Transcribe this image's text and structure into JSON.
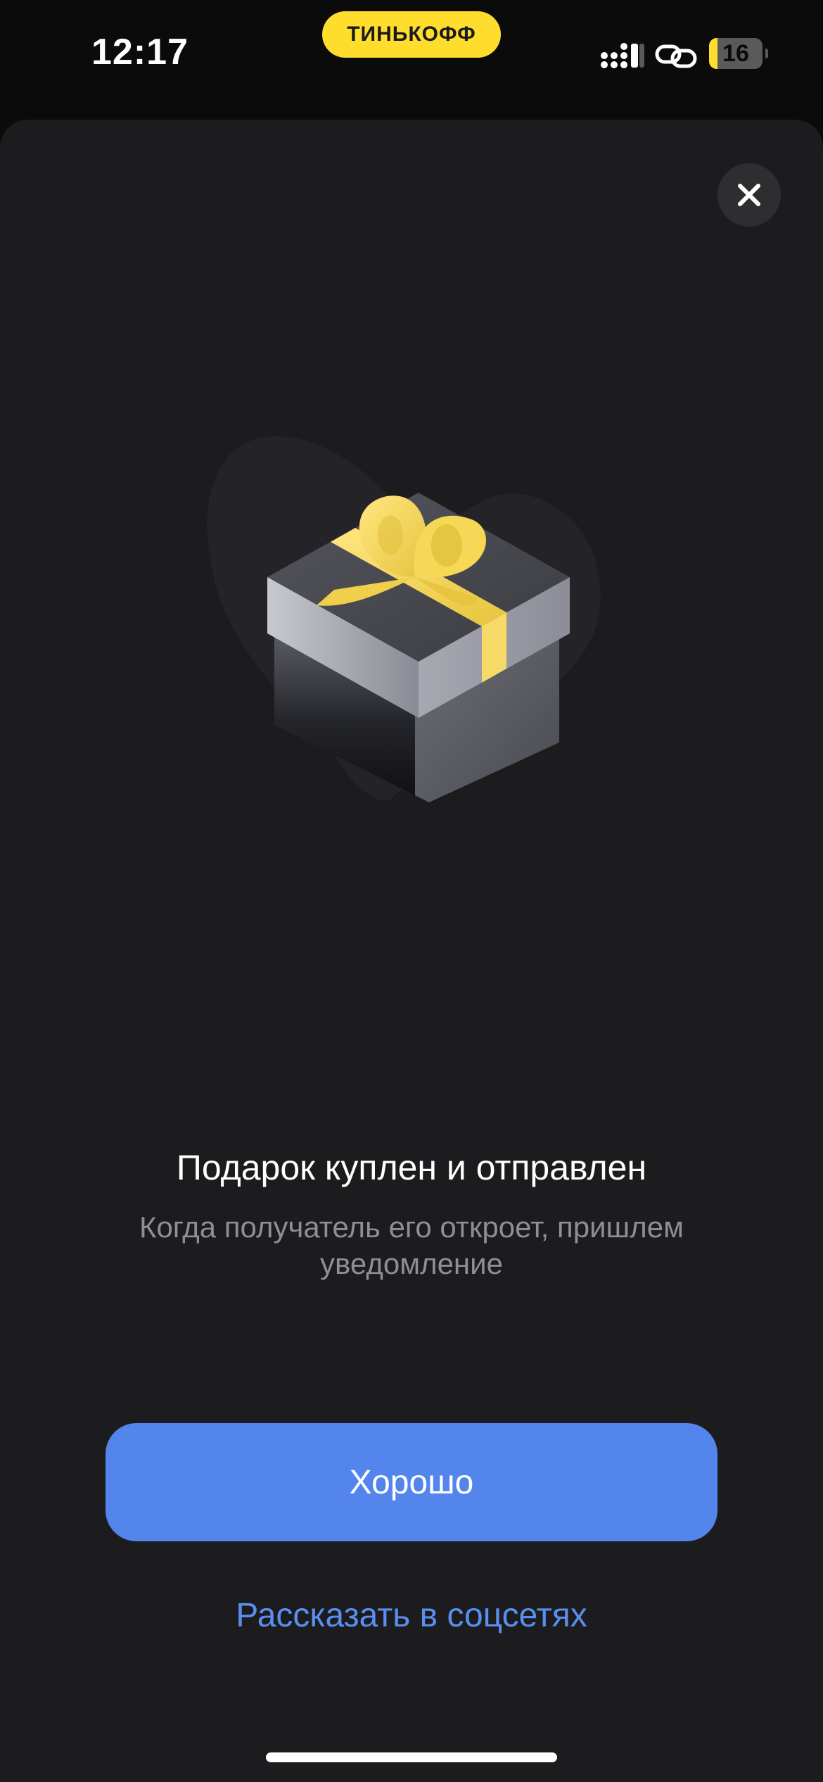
{
  "status_bar": {
    "time": "12:17",
    "brand": "ТИНЬКОФФ",
    "battery_level": "16",
    "battery_fraction": 0.16,
    "icons": [
      "signal-icon",
      "link-icon",
      "battery-icon"
    ]
  },
  "dialog": {
    "close_icon": "close-icon",
    "illustration": "gift-box-illustration",
    "title": "Подарок куплен и отправлен",
    "subtitle": "Когда получатель его откроет, пришлем уведомление",
    "primary_button": "Хорошо",
    "secondary_link": "Рассказать в соцсетях"
  },
  "colors": {
    "brand_yellow": "#ffdd2d",
    "accent_blue": "#5385ed",
    "link_blue": "#5a8ef0",
    "sheet_background": "#1c1c1e"
  }
}
